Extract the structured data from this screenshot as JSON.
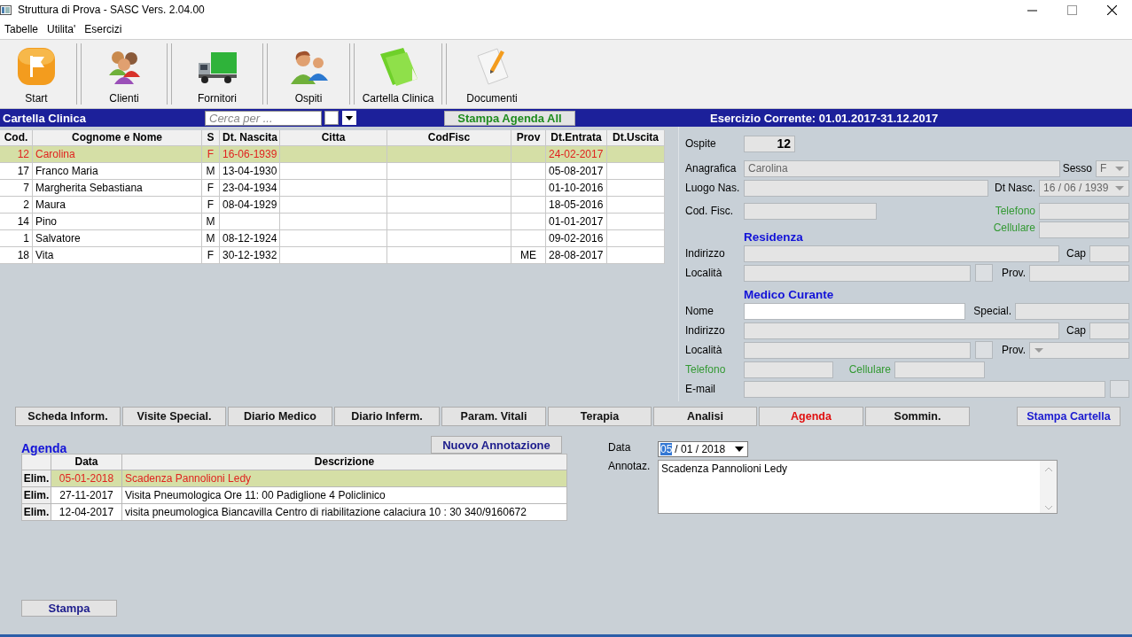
{
  "window": {
    "title": "Struttura di Prova - SASC Vers. 2.04.00"
  },
  "menu": [
    "Tabelle",
    "Utilita'",
    "Esercizi"
  ],
  "toolbar": [
    {
      "label": "Start",
      "kind": "flag"
    },
    {
      "label": "Clienti",
      "kind": "people"
    },
    {
      "label": "Fornitori",
      "kind": "truck"
    },
    {
      "label": "Ospiti",
      "kind": "guests"
    },
    {
      "label": "Cartella Clinica",
      "kind": "folder"
    },
    {
      "label": "Documenti",
      "kind": "document"
    }
  ],
  "header": {
    "title": "Cartella Clinica",
    "search": {
      "placeholder": "Cerca per ..."
    },
    "filter_checkbox": {
      "checked": false
    },
    "print_button": "Stampa Agenda All",
    "period": "Esercizio Corrente: 01.01.2017-31.12.2017"
  },
  "patients": {
    "columns": [
      "Cod.",
      "Cognome e Nome",
      "S",
      "Dt. Nascita",
      "Citta",
      "CodFisc",
      "Prov",
      "Dt.Entrata",
      "Dt.Uscita"
    ],
    "rows": [
      {
        "cells": [
          "12",
          "Carolina",
          "F",
          "16-06-1939",
          null,
          null,
          null,
          "24-02-2017",
          null
        ],
        "selected": true
      },
      {
        "cells": [
          "17",
          "Franco Maria",
          "M",
          "13-04-1930",
          null,
          null,
          null,
          "05-08-2017",
          null
        ],
        "selected": false
      },
      {
        "cells": [
          "7",
          "Margherita Sebastiana",
          "F",
          "23-04-1934",
          null,
          null,
          null,
          "01-10-2016",
          null
        ],
        "selected": false
      },
      {
        "cells": [
          "2",
          "Maura",
          "F",
          "08-04-1929",
          null,
          null,
          null,
          "18-05-2016",
          null
        ],
        "selected": false
      },
      {
        "cells": [
          "14",
          "Pino",
          "M",
          null,
          null,
          null,
          null,
          "01-01-2017",
          null
        ],
        "selected": false
      },
      {
        "cells": [
          "1",
          "Salvatore",
          "M",
          "08-12-1924",
          null,
          null,
          null,
          "09-02-2016",
          null
        ],
        "selected": false
      },
      {
        "cells": [
          "18",
          "Vita",
          "F",
          "30-12-1932",
          null,
          null,
          "ME",
          "28-08-2017",
          null
        ],
        "selected": false
      }
    ]
  },
  "form": [
    {
      "items": [
        {
          "kind": "label",
          "text": "Ospite"
        },
        {
          "kind": "idfield",
          "value": "12",
          "disabled": true
        }
      ]
    },
    {
      "items": [
        {
          "kind": "label",
          "text": "Anagrafica"
        },
        {
          "kind": "field",
          "value": "Carolina",
          "disabled": true
        },
        {
          "kind": "label",
          "text": "Sesso"
        },
        {
          "kind": "combo",
          "value": "F",
          "disabled": true
        }
      ]
    },
    {
      "items": [
        {
          "kind": "label",
          "text": "Luogo Nas."
        },
        {
          "kind": "field",
          "disabled": true
        },
        {
          "kind": "label",
          "text": "Dt Nasc."
        },
        {
          "kind": "combo",
          "value": "16 / 06 / 1939",
          "disabled": true
        }
      ]
    },
    {
      "items": [
        {
          "kind": "label",
          "text": "Cod. Fisc."
        },
        {
          "kind": "field",
          "disabled": true
        },
        {
          "kind": "label",
          "text": "Telefono",
          "color": "#339933"
        },
        {
          "kind": "field",
          "disabled": true
        }
      ]
    },
    {
      "items": [
        {
          "kind": "heading",
          "text": "Residenza"
        },
        {
          "kind": "label",
          "text": "Cellulare",
          "color": "#339933"
        },
        {
          "kind": "field",
          "disabled": true
        }
      ]
    },
    {
      "items": [
        {
          "kind": "label",
          "text": "Indirizzo"
        },
        {
          "kind": "field",
          "disabled": true
        },
        {
          "kind": "label",
          "text": "Cap"
        },
        {
          "kind": "field",
          "disabled": true
        }
      ]
    },
    {
      "items": [
        {
          "kind": "label",
          "text": "Località"
        },
        {
          "kind": "field",
          "disabled": true
        },
        {
          "kind": "button"
        },
        {
          "kind": "label",
          "text": "Prov."
        },
        {
          "kind": "field",
          "disabled": true
        }
      ]
    },
    {
      "items": [
        {
          "kind": "heading",
          "text": "Medico Curante"
        }
      ]
    },
    {
      "items": [
        {
          "kind": "label",
          "text": "Nome"
        },
        {
          "kind": "field",
          "disabled": false
        },
        {
          "kind": "label",
          "text": "Special."
        },
        {
          "kind": "field",
          "disabled": true
        }
      ]
    },
    {
      "items": [
        {
          "kind": "label",
          "text": "Indirizzo"
        },
        {
          "kind": "field",
          "disabled": true
        },
        {
          "kind": "label",
          "text": "Cap"
        },
        {
          "kind": "field",
          "disabled": true
        }
      ]
    },
    {
      "items": [
        {
          "kind": "label",
          "text": "Località"
        },
        {
          "kind": "field",
          "disabled": true
        },
        {
          "kind": "button"
        },
        {
          "kind": "label",
          "text": "Prov."
        },
        {
          "kind": "combo",
          "disabled": true
        }
      ]
    },
    {
      "items": [
        {
          "kind": "label",
          "text": "Telefono",
          "color": "#339933"
        },
        {
          "kind": "field",
          "disabled": true
        },
        {
          "kind": "label",
          "text": "Cellulare",
          "color": "#339933"
        },
        {
          "kind": "field",
          "disabled": true
        }
      ]
    },
    {
      "items": [
        {
          "kind": "label",
          "text": "E-mail"
        },
        {
          "kind": "field",
          "disabled": true
        },
        {
          "kind": "button"
        }
      ]
    }
  ],
  "tabs": [
    {
      "label": "Scheda Inform.",
      "selected": false
    },
    {
      "label": "Visite Special.",
      "selected": false
    },
    {
      "label": "Diario Medico",
      "selected": false
    },
    {
      "label": "Diario Inferm.",
      "selected": false
    },
    {
      "label": "Param. Vitali",
      "selected": false
    },
    {
      "label": "Terapia",
      "selected": false
    },
    {
      "label": "Analisi",
      "selected": false
    },
    {
      "label": "Agenda",
      "selected": true
    },
    {
      "label": "Sommin.",
      "selected": false
    }
  ],
  "print_record_button": "Stampa Cartella",
  "agenda": {
    "title": "Agenda",
    "new_button": "Nuovo Annotazione",
    "columns": [
      "Data",
      "Descrizione"
    ],
    "rows": [
      {
        "action": "Elim.",
        "date": "05-01-2018",
        "description": "Scadenza Pannolioni Ledy",
        "selected": true
      },
      {
        "action": "Elim.",
        "date": "27-11-2017",
        "description": "Visita Pneumologica  Ore 11: 00 Padiglione 4 Policlinico",
        "selected": false
      },
      {
        "action": "Elim.",
        "date": "12-04-2017",
        "description": "visita pneumologica Biancavilla Centro di riabilitazione calaciura  10 : 30 340/9160672",
        "selected": false
      }
    ],
    "print_button": "Stampa",
    "date_label": "Data",
    "date_segments": [
      {
        "text": "05",
        "selected": true
      },
      {
        "text": "/ 01 / 2018",
        "selected": false
      }
    ],
    "note_label": "Annotaz.",
    "note": "Scadenza Pannolioni Ledy"
  }
}
